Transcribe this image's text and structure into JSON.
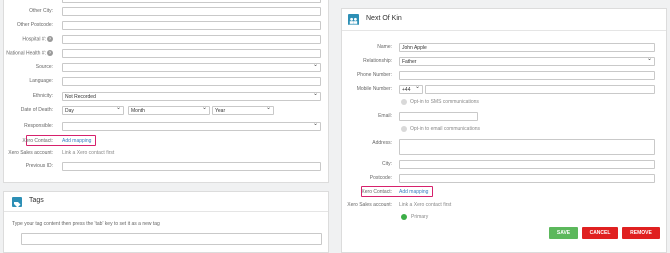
{
  "form": {
    "other_city_label": "Other City:",
    "other_postcode_label": "Other Postcode:",
    "hospital_label": "Hospital #:",
    "national_health_label": "National Health #:",
    "source_label": "Source:",
    "language_label": "Language:",
    "ethnicity_label": "Ethnicity:",
    "ethnicity_value": "Not Recorded",
    "date_of_death_label": "Date of Death:",
    "dod_day": "Day",
    "dod_month": "Month",
    "dod_year": "Year",
    "responsible_label": "Responsible:",
    "xero_contact_label": "Xero Contact:",
    "xero_add_mapping": "Add mapping",
    "xero_sales_label": "Xero Sales account:",
    "xero_sales_value": "Link a Xero contact first",
    "previous_id_label": "Previous ID:",
    "help_icon_glyph": "?"
  },
  "tags": {
    "title": "Tags",
    "hint": "Type your tag content then press the 'tab' key to set it as a new tag"
  },
  "next_of_kin": {
    "title": "Next Of Kin",
    "name_label": "Name:",
    "name_value": "John Apple",
    "relationship_label": "Relationship:",
    "relationship_value": "Father",
    "phone_label": "Phone Number:",
    "mobile_label": "Mobile Number:",
    "mobile_code": "+44",
    "sms_optin": "Opt-in to SMS communications",
    "email_label": "Email:",
    "email_optin": "Opt-in to email communications",
    "address_label": "Address:",
    "city_label": "City:",
    "postcode_label": "Postcode:",
    "xero_contact_label": "Xero Contact:",
    "xero_add_mapping": "Add mapping",
    "xero_sales_label": "Xero Sales account:",
    "xero_sales_value": "Link a Xero contact first",
    "primary_label": "Primary"
  },
  "buttons": {
    "save": "SAVE",
    "cancel": "CANCEL",
    "remove": "REMOVE"
  },
  "colors": {
    "highlight": "#d6216c",
    "save": "#5cb85c",
    "cancel": "#e02020",
    "remove": "#e02020",
    "link": "#3a7fc1",
    "icon": "#2d8fb5"
  }
}
